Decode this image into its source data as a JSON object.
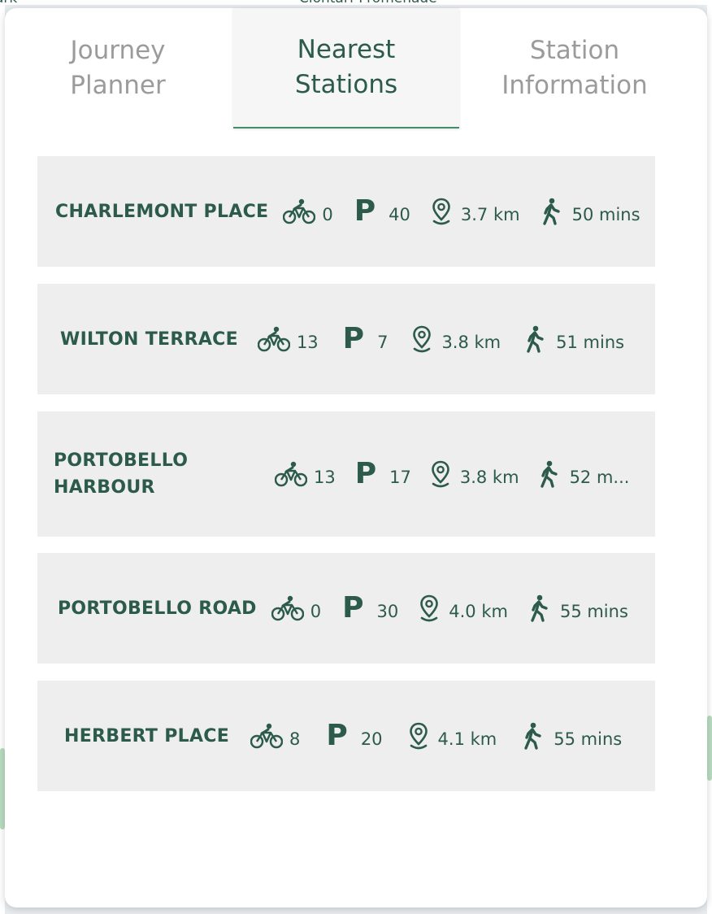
{
  "map": {
    "labels": [
      "Clontarf Promenade",
      "ark"
    ]
  },
  "tabs": [
    {
      "label_line1": "Journey",
      "label_line2": "Planner",
      "active": false
    },
    {
      "label_line1": "Nearest",
      "label_line2": "Stations",
      "active": true
    },
    {
      "label_line1": "Station",
      "label_line2": "Information",
      "active": false
    }
  ],
  "icons": {
    "bikes": "bicycle-icon",
    "stands": "parking-icon",
    "distance": "location-pin-icon",
    "walk": "walking-person-icon",
    "stands_glyph": "P"
  },
  "colors": {
    "accent": "#2c5a4b",
    "active_underline": "#3f8e6e",
    "card_bg": "#eeeeee",
    "inactive_tab": "#9b9b9b"
  },
  "stations": [
    {
      "name": "CHARLEMONT PLACE",
      "name_line2": "",
      "bikes": "0",
      "stands": "40",
      "distance": "3.7 km",
      "walk": "50 mins"
    },
    {
      "name": "WILTON TERRACE",
      "name_line2": "",
      "bikes": "13",
      "stands": "7",
      "distance": "3.8 km",
      "walk": "51 mins"
    },
    {
      "name": "PORTOBELLO",
      "name_line2": "HARBOUR",
      "bikes": "13",
      "stands": "17",
      "distance": "3.8 km",
      "walk": "52 m..."
    },
    {
      "name": "PORTOBELLO ROAD",
      "name_line2": "",
      "bikes": "0",
      "stands": "30",
      "distance": "4.0 km",
      "walk": "55 mins"
    },
    {
      "name": "HERBERT PLACE",
      "name_line2": "",
      "bikes": "8",
      "stands": "20",
      "distance": "4.1 km",
      "walk": "55 mins"
    }
  ]
}
